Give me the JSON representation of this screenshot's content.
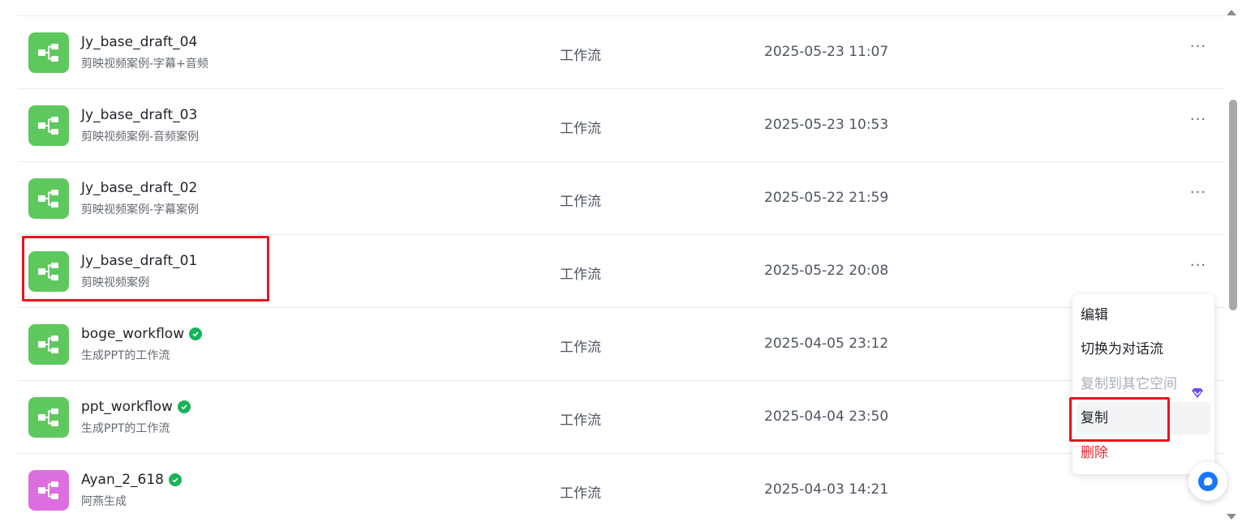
{
  "rows": [
    {
      "name": "Jy_base_draft_04",
      "desc": "剪映视频案例-字幕+音频",
      "type": "工作流",
      "date": "2025-05-23 11:07",
      "verified": false,
      "icon_color": "#5ec85e"
    },
    {
      "name": "Jy_base_draft_03",
      "desc": "剪映视频案例-音频案例",
      "type": "工作流",
      "date": "2025-05-23 10:53",
      "verified": false,
      "icon_color": "#5ec85e"
    },
    {
      "name": "Jy_base_draft_02",
      "desc": "剪映视频案例-字幕案例",
      "type": "工作流",
      "date": "2025-05-22 21:59",
      "verified": false,
      "icon_color": "#5ec85e"
    },
    {
      "name": "Jy_base_draft_01",
      "desc": "剪映视频案例",
      "type": "工作流",
      "date": "2025-05-22 20:08",
      "verified": false,
      "icon_color": "#5ec85e"
    },
    {
      "name": "boge_workflow",
      "desc": "生成PPT的工作流",
      "type": "工作流",
      "date": "2025-04-05 23:12",
      "verified": true,
      "icon_color": "#5ec85e"
    },
    {
      "name": "ppt_workflow",
      "desc": "生成PPT的工作流",
      "type": "工作流",
      "date": "2025-04-04 23:50",
      "verified": true,
      "icon_color": "#5ec85e"
    },
    {
      "name": "Ayan_2_618",
      "desc": "阿燕生成",
      "type": "工作流",
      "date": "2025-04-03 14:21",
      "verified": true,
      "icon_color": "#dd6ee0"
    }
  ],
  "more_label": "···",
  "context_menu": {
    "items": [
      {
        "label": "编辑",
        "state": "normal"
      },
      {
        "label": "切换为对话流",
        "state": "normal"
      },
      {
        "label": "复制到其它空间",
        "state": "disabled",
        "icon": "premium-gem-icon"
      },
      {
        "label": "复制",
        "state": "active"
      },
      {
        "label": "删除",
        "state": "danger"
      }
    ]
  },
  "colors": {
    "workflow_icon": "#5ec85e",
    "workflow_icon_alt": "#dd6ee0",
    "verified": "#18b35a",
    "danger": "#e8262e",
    "annotation": "#e8141c",
    "premium": "#6b4cf5",
    "assistant": "#1677ff"
  }
}
